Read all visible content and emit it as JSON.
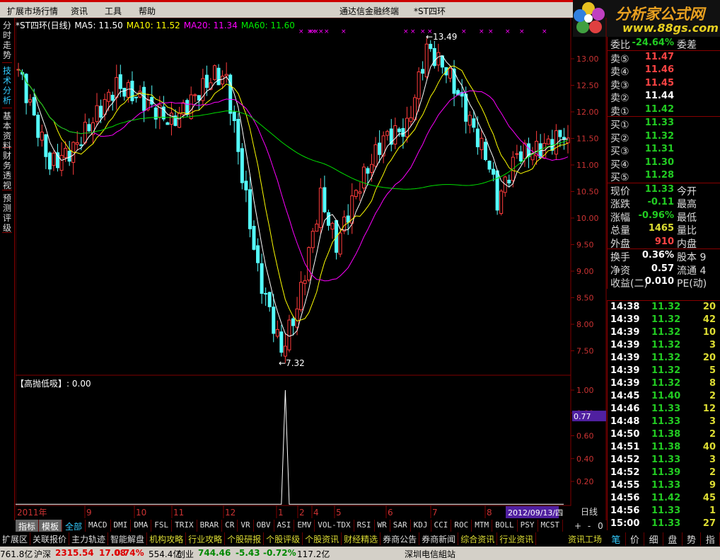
{
  "menu": [
    "扩展市场行情",
    "资讯",
    "工具",
    "帮助"
  ],
  "app_title": "通达信金融终端",
  "stock_name": "*ST四环",
  "logo": {
    "text": "分析家公式网",
    "url_text": "www.88gs.com"
  },
  "side_tabs": [
    "分时走势",
    "技术分析",
    "基本资料",
    "财务透视",
    "预测评级"
  ],
  "chart_title": {
    "name": "*ST四环(日线)",
    "ma5": "MA5: 11.50",
    "ma10": "MA10: 11.52",
    "ma20": "MA20: 11.34",
    "ma60": "MA60: 11.60"
  },
  "colors": {
    "up": "#ff3c3c",
    "down": "#54fcfc",
    "ma5": "#ffffff",
    "ma10": "#ffff00",
    "ma20": "#ff00ff",
    "ma60": "#00e000",
    "grid": "#800000"
  },
  "chart_data": {
    "type": "candlestick",
    "y_ticks": [
      "13.00",
      "12.50",
      "12.00",
      "11.50",
      "11.00",
      "10.50",
      "10.00",
      "9.50",
      "9.00",
      "8.50",
      "8.00",
      "7.50"
    ],
    "ylim": [
      7.3,
      13.5
    ],
    "close_keypoints": [
      [
        0,
        12.8
      ],
      [
        8,
        11.0
      ],
      [
        14,
        11.3
      ],
      [
        25,
        12.5
      ],
      [
        32,
        12.2
      ],
      [
        39,
        11.8
      ],
      [
        50,
        12.7
      ],
      [
        53,
        12.6
      ],
      [
        61,
        9.0
      ],
      [
        67,
        7.5
      ],
      [
        71,
        8.3
      ],
      [
        77,
        10.4
      ],
      [
        81,
        9.5
      ],
      [
        86,
        10.5
      ],
      [
        93,
        11.5
      ],
      [
        99,
        11.7
      ],
      [
        104,
        13.2
      ],
      [
        109,
        12.8
      ],
      [
        114,
        12.0
      ],
      [
        120,
        11.0
      ],
      [
        122,
        10.3
      ],
      [
        127,
        11.2
      ],
      [
        133,
        11.3
      ],
      [
        139,
        11.6
      ],
      [
        140,
        11.33
      ]
    ],
    "annotations": {
      "high": "13.49",
      "low": "7.32"
    },
    "x_labels": [
      "2011年",
      "9",
      "10",
      "11",
      "12",
      "1",
      "2",
      "4",
      "5",
      "6",
      "7",
      "8"
    ],
    "date_label": "2012/09/13/四",
    "indicator": {
      "title": "【高抛低吸】",
      "value_text": ": 0.00",
      "y_ticks": [
        "1.00",
        "0.80",
        "0.60",
        "0.40",
        "0.20"
      ],
      "current": "0.77",
      "spike_index": 68,
      "spike_value": 1.0
    }
  },
  "quote": {
    "wb": {
      "label": "委比",
      "value": "-24.64%",
      "right": "委差"
    },
    "sell": [
      {
        "label": "卖⑤",
        "value": "11.47"
      },
      {
        "label": "卖④",
        "value": "11.46"
      },
      {
        "label": "卖③",
        "value": "11.45"
      },
      {
        "label": "卖②",
        "value": "11.44"
      },
      {
        "label": "卖①",
        "value": "11.42"
      }
    ],
    "buy": [
      {
        "label": "买①",
        "value": "11.33"
      },
      {
        "label": "买②",
        "value": "11.32"
      },
      {
        "label": "买③",
        "value": "11.31"
      },
      {
        "label": "买④",
        "value": "11.30"
      },
      {
        "label": "买⑤",
        "value": "11.28"
      }
    ],
    "stats": [
      {
        "label": "现价",
        "value": "11.33",
        "right": "今开"
      },
      {
        "label": "涨跌",
        "value": "-0.11",
        "right": "最高"
      },
      {
        "label": "涨幅",
        "value": "-0.96%",
        "right": "最低"
      },
      {
        "label": "总量",
        "value": "1465",
        "right": "量比"
      },
      {
        "label": "外盘",
        "value": "910",
        "right": "内盘"
      }
    ],
    "stats2": [
      {
        "label": "换手",
        "value": "0.36%",
        "right": "股本 9"
      },
      {
        "label": "净资",
        "value": "0.57",
        "right": "流通 4"
      },
      {
        "label": "收益(二)",
        "value": "0.010",
        "right": "PE(动)"
      }
    ]
  },
  "ticks": [
    [
      "14:38",
      "11.32",
      "20"
    ],
    [
      "14:39",
      "11.32",
      "42"
    ],
    [
      "14:39",
      "11.32",
      "10"
    ],
    [
      "14:39",
      "11.32",
      "3"
    ],
    [
      "14:39",
      "11.32",
      "20"
    ],
    [
      "14:39",
      "11.32",
      "5"
    ],
    [
      "14:39",
      "11.32",
      "8"
    ],
    [
      "14:45",
      "11.40",
      "2"
    ],
    [
      "14:46",
      "11.33",
      "12"
    ],
    [
      "14:48",
      "11.33",
      "3"
    ],
    [
      "14:50",
      "11.38",
      "2"
    ],
    [
      "14:51",
      "11.38",
      "40"
    ],
    [
      "14:52",
      "11.33",
      "3"
    ],
    [
      "14:52",
      "11.39",
      "2"
    ],
    [
      "14:55",
      "11.33",
      "9"
    ],
    [
      "14:56",
      "11.42",
      "45"
    ],
    [
      "14:56",
      "11.33",
      "1"
    ],
    [
      "15:00",
      "11.33",
      "27"
    ]
  ],
  "period": "日线",
  "zoom_buttons": [
    "+",
    "-",
    "0"
  ],
  "tabs1": [
    "指标",
    "模板",
    "全部",
    "MACD",
    "DMI",
    "DMA",
    "FSL",
    "TRIX",
    "BRAR",
    "CR",
    "VR",
    "OBV",
    "ASI",
    "EMV",
    "VOL-TDX",
    "RSI",
    "WR",
    "SAR",
    "KDJ",
    "CCI",
    "ROC",
    "MTM",
    "BOLL",
    "PSY",
    "MCST"
  ],
  "tabs2": [
    "扩展区",
    "关联报价",
    "主力轨迹",
    "智能解盘",
    "机构攻略",
    "行业攻略",
    "个股研报",
    "个股评级",
    "个股资讯",
    "财经精选",
    "券商公告",
    "券商新闻",
    "综合资讯",
    "行业资讯"
  ],
  "tabs2_right": "资讯工场",
  "bottom_tabs": [
    "笔",
    "价",
    "细",
    "盘",
    "势",
    "指"
  ],
  "status": {
    "a": "761.8亿",
    "sh": "沪深",
    "sh_v": "2315.54",
    "sh_c": "17.08",
    "sh_p": "0.74%",
    "sh_a": "554.4亿",
    "cy": "创业",
    "cy_v": "744.46",
    "cy_c": "-5.43",
    "cy_p": "-0.72%",
    "cy_a": "117.2亿",
    "site": "深圳电信組站"
  }
}
